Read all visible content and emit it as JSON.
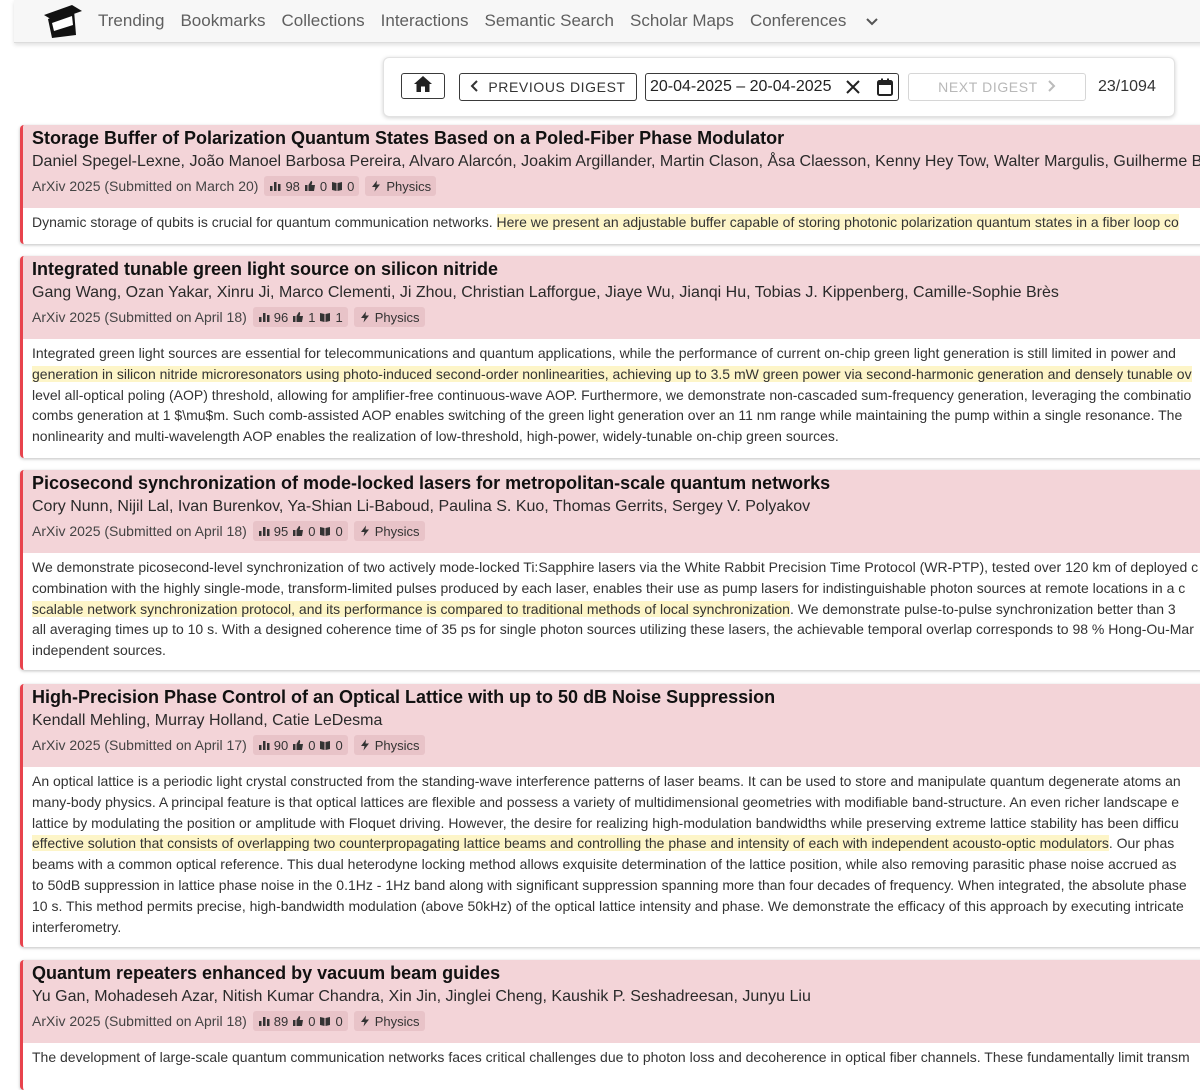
{
  "nav": {
    "items": [
      "Trending",
      "Bookmarks",
      "Collections",
      "Interactions",
      "Semantic Search",
      "Scholar Maps",
      "Conferences"
    ]
  },
  "toolbar": {
    "prev_label": "PREVIOUS DIGEST",
    "date_range": "20-04-2025 – 20-04-2025",
    "next_label": "NEXT DIGEST",
    "counter": "23/1094"
  },
  "colors": {
    "accent": "#e8434d",
    "header_bg": "#f3d4d8",
    "highlight": "#fdf5c8"
  },
  "papers": [
    {
      "title": "Storage Buffer of Polarization Quantum States Based on a Poled-Fiber Phase Modulator",
      "authors": "Daniel Spegel-Lexne, João Manoel Barbosa Pereira, Alvaro Alarcón, Joakim Argillander, Martin Clason, Åsa Claesson, Kenny Hey Tow, Walter Margulis, Guilherme B.",
      "venue": "ArXiv 2025 (Submitted on March 20)",
      "stats": {
        "views": "98",
        "likes": "0",
        "saves": "0"
      },
      "category": "Physics",
      "abstract": [
        [
          {
            "t": "Dynamic storage of qubits is crucial for quantum communication networks. ",
            "h": false
          },
          {
            "t": "Here we present an adjustable buffer capable of storing photonic polarization quantum states in a fiber loop co",
            "h": true
          }
        ]
      ]
    },
    {
      "title": "Integrated tunable green light source on silicon nitride",
      "authors": "Gang Wang, Ozan Yakar, Xinru Ji, Marco Clementi, Ji Zhou, Christian Lafforgue, Jiaye Wu, Jianqi Hu, Tobias J. Kippenberg, Camille-Sophie Brès",
      "venue": "ArXiv 2025 (Submitted on April 18)",
      "stats": {
        "views": "96",
        "likes": "1",
        "saves": "1"
      },
      "category": "Physics",
      "abstract": [
        [
          {
            "t": "Integrated green light sources are essential for telecommunications and quantum applications, while the performance of current on-chip green light generation is still limited in power and",
            "h": false
          }
        ],
        [
          {
            "t": "generation in silicon nitride microresonators using photo-induced second-order nonlinearities, achieving up to 3.5 mW green power via second-harmonic generation and densely tunable ov",
            "h": true
          }
        ],
        [
          {
            "t": "level all-optical poling (AOP) threshold, allowing for amplifier-free continuous-wave AOP. Furthermore, we demonstrate non-cascaded sum-frequency generation, leveraging the combinatio",
            "h": false
          }
        ],
        [
          {
            "t": "combs generation at 1 $\\mu$m. Such comb-assisted AOP enables switching of the green light generation over an 11 nm range while maintaining the pump within a single resonance. The",
            "h": false
          }
        ],
        [
          {
            "t": "nonlinearity and multi-wavelength AOP enables the realization of low-threshold, high-power, widely-tunable on-chip green sources.",
            "h": false
          }
        ]
      ]
    },
    {
      "title": "Picosecond synchronization of mode-locked lasers for metropolitan-scale quantum networks",
      "authors": "Cory Nunn, Nijil Lal, Ivan Burenkov, Ya-Shian Li-Baboud, Paulina S. Kuo, Thomas Gerrits, Sergey V. Polyakov",
      "venue": "ArXiv 2025 (Submitted on April 18)",
      "stats": {
        "views": "95",
        "likes": "0",
        "saves": "0"
      },
      "category": "Physics",
      "abstract": [
        [
          {
            "t": "We demonstrate picosecond-level synchronization of two actively mode-locked Ti:Sapphire lasers via the White Rabbit Precision Time Protocol (WR-PTP), tested over 120 km of deployed c",
            "h": false
          }
        ],
        [
          {
            "t": "combination with the highly single-mode, transform-limited pulses produced by each laser, enables their use as pump lasers for indistinguishable photon sources at remote locations in a c",
            "h": false
          }
        ],
        [
          {
            "t": "scalable network synchronization protocol, and its performance is compared to traditional methods of local synchronization",
            "h": true
          },
          {
            "t": ". We demonstrate pulse-to-pulse synchronization better than 3",
            "h": false
          }
        ],
        [
          {
            "t": "all averaging times up to 10 s. With a designed coherence time of 35 ps for single photon sources utilizing these lasers, the achievable temporal overlap corresponds to 98 % Hong-Ou-Mar",
            "h": false
          }
        ],
        [
          {
            "t": "independent sources.",
            "h": false
          }
        ]
      ]
    },
    {
      "title": "High-Precision Phase Control of an Optical Lattice with up to 50 dB Noise Suppression",
      "authors": "Kendall Mehling, Murray Holland, Catie LeDesma",
      "venue": "ArXiv 2025 (Submitted on April 17)",
      "stats": {
        "views": "90",
        "likes": "0",
        "saves": "0"
      },
      "category": "Physics",
      "abstract": [
        [
          {
            "t": "An optical lattice is a periodic light crystal constructed from the standing-wave interference patterns of laser beams. It can be used to store and manipulate quantum degenerate atoms an",
            "h": false
          }
        ],
        [
          {
            "t": "many-body physics. A principal feature is that optical lattices are flexible and possess a variety of multidimensional geometries with modifiable band-structure. An even richer landscape e",
            "h": false
          }
        ],
        [
          {
            "t": "lattice by modulating the position or amplitude with Floquet driving. However, the desire for realizing high-modulation bandwidths while preserving extreme lattice stability has been difficu",
            "h": false
          }
        ],
        [
          {
            "t": "effective solution that consists of overlapping two counterpropagating lattice beams and controlling the phase and intensity of each with independent acousto-optic modulators",
            "h": true
          },
          {
            "t": ". Our phas",
            "h": false
          }
        ],
        [
          {
            "t": "beams with a common optical reference. This dual heterodyne locking method allows exquisite determination of the lattice position, while also removing parasitic phase noise accrued as",
            "h": false
          }
        ],
        [
          {
            "t": "to 50dB suppression in lattice phase noise in the 0.1Hz - 1Hz band along with significant suppression spanning more than four decades of frequency. When integrated, the absolute phase",
            "h": false
          }
        ],
        [
          {
            "t": "10 s. This method permits precise, high-bandwidth modulation (above 50kHz) of the optical lattice intensity and phase. We demonstrate the efficacy of this approach by executing intricate",
            "h": false
          }
        ],
        [
          {
            "t": "interferometry.",
            "h": false
          }
        ]
      ]
    },
    {
      "title": "Quantum repeaters enhanced by vacuum beam guides",
      "authors": "Yu Gan, Mohadeseh Azar, Nitish Kumar Chandra, Xin Jin, Jinglei Cheng, Kaushik P. Seshadreesan, Junyu Liu",
      "venue": "ArXiv 2025 (Submitted on April 18)",
      "stats": {
        "views": "89",
        "likes": "0",
        "saves": "0"
      },
      "category": "Physics",
      "abstract": [
        [
          {
            "t": "The development of large-scale quantum communication networks faces critical challenges due to photon loss and decoherence in optical fiber channels. These fundamentally limit transm",
            "h": false
          }
        ]
      ]
    }
  ]
}
